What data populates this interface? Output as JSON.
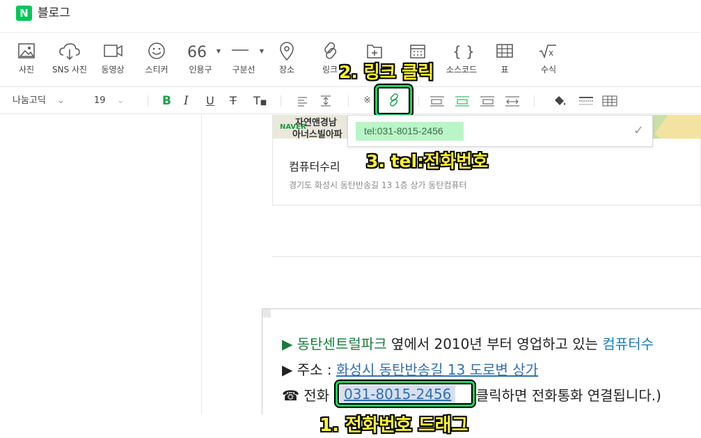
{
  "header": {
    "logo": "N",
    "title": "블로그"
  },
  "insert_toolbar": [
    {
      "label": "사진",
      "icon": "photo-icon"
    },
    {
      "label": "SNS 사진",
      "icon": "sns-photo-icon"
    },
    {
      "label": "동영상",
      "icon": "video-icon"
    },
    {
      "label": "스티커",
      "icon": "sticker-icon"
    },
    {
      "label": "인용구",
      "icon": "quote-icon"
    },
    {
      "label": "구분선",
      "icon": "divider-icon"
    },
    {
      "label": "장소",
      "icon": "place-icon"
    },
    {
      "label": "링크",
      "icon": "link-icon"
    },
    {
      "label": "소스코드",
      "icon": "source-code-icon"
    },
    {
      "label": "표",
      "icon": "table-icon"
    },
    {
      "label": "수식",
      "icon": "formula-icon"
    }
  ],
  "format_toolbar": {
    "font": "나눔고딕",
    "size": "19"
  },
  "map_card": {
    "name": "컴퓨터수리",
    "address": "경기도 화성시 동탄반송길 13 1층 상가 동탄컴퓨터",
    "map_text1": "자연앤경남",
    "map_text2": "아너스빌아파",
    "map_brand": "NAVER"
  },
  "link_popup": {
    "value": "tel:031-8015-2456"
  },
  "content": {
    "line1": {
      "bullet": "▶",
      "green": "동탄센트럴파크",
      "mid": " 옆에서 2010년 부터 영업하고 있는 ",
      "blue": "컴퓨터수"
    },
    "line2": {
      "bullet": "▶",
      "label": "주소 : ",
      "link": "화성시 동탄반송길 13 도로변 상가"
    },
    "line3": {
      "phone_icon": "☎",
      "label": "전화 ",
      "phone": "031-8015-2456",
      "rest": " 클릭하면 전화통화 연결됩니다.)"
    }
  },
  "annotations": {
    "step1": "1. 전화번호 드래그",
    "step2": "2. 링크 클릭",
    "step3": "3. tel:전화번호"
  },
  "colors": {
    "brand": "#03c75a",
    "highlight_border": "#16d45a",
    "annotation": "#fff330",
    "selection": "#d7dff0",
    "link_input_bg": "#b9f5c6"
  }
}
